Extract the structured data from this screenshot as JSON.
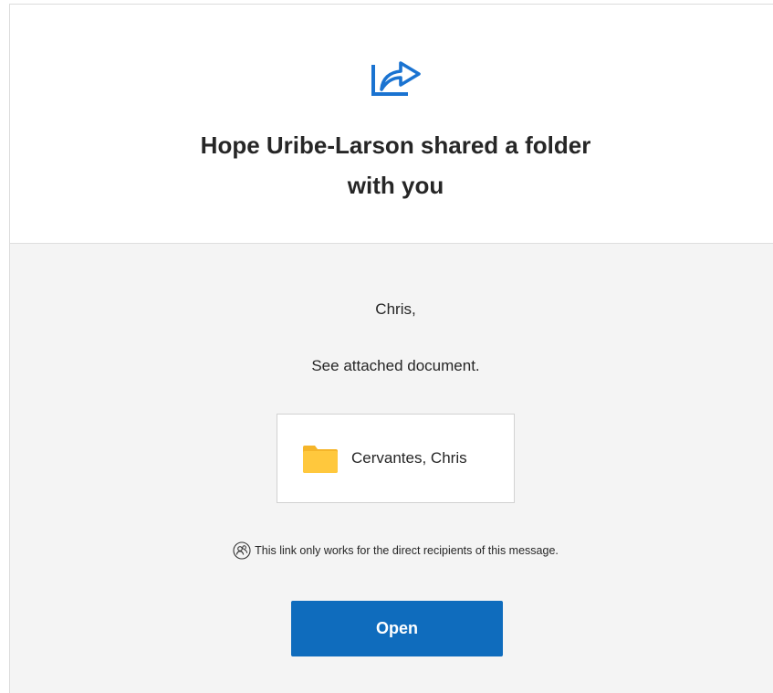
{
  "header": {
    "icon": "share-arrow-icon",
    "title_line1": "Hope Uribe-Larson shared a folder",
    "title_line2": "with you"
  },
  "body": {
    "greeting": "Chris,",
    "message": "See attached document.",
    "folder": {
      "icon": "folder-icon",
      "name": "Cervantes, Chris"
    },
    "notice": {
      "icon": "people-icon",
      "text": "This link only works for the direct recipients of this message."
    },
    "open_button_label": "Open"
  },
  "colors": {
    "accent": "#0f6cbd",
    "folder": "#ffc83d",
    "body_background": "#f4f4f4",
    "text": "#262626"
  }
}
